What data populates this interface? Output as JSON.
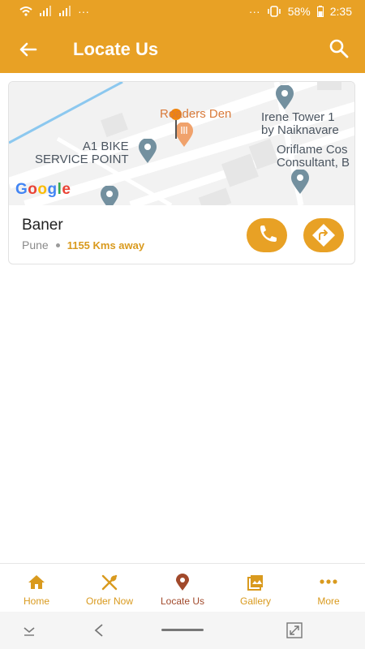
{
  "status_bar": {
    "battery": "58%",
    "time": "2:35",
    "dots_left": "···",
    "dots_right": "···"
  },
  "header": {
    "title": "Locate Us"
  },
  "map": {
    "labels": {
      "poi": "Roaders Den",
      "bike": "A1 BIKE\nSERVICE POINT",
      "tower": "Irene Tower 1\nby Naiknavare",
      "oriflame": "Oriflame Cos\nConsultant, B"
    },
    "brand": "Google"
  },
  "location": {
    "name": "Baner",
    "city": "Pune",
    "distance": "1155 Kms away"
  },
  "nav": {
    "items": [
      {
        "label": "Home",
        "icon": "home-icon"
      },
      {
        "label": "Order Now",
        "icon": "fork-spoon-icon"
      },
      {
        "label": "Locate Us",
        "icon": "location-pin-icon"
      },
      {
        "label": "Gallery",
        "icon": "gallery-icon"
      },
      {
        "label": "More",
        "icon": "more-dots-icon"
      }
    ],
    "active_index": 2
  },
  "colors": {
    "primary": "#e8a125",
    "accent_text": "#d99a1e",
    "active": "#a1492b"
  }
}
